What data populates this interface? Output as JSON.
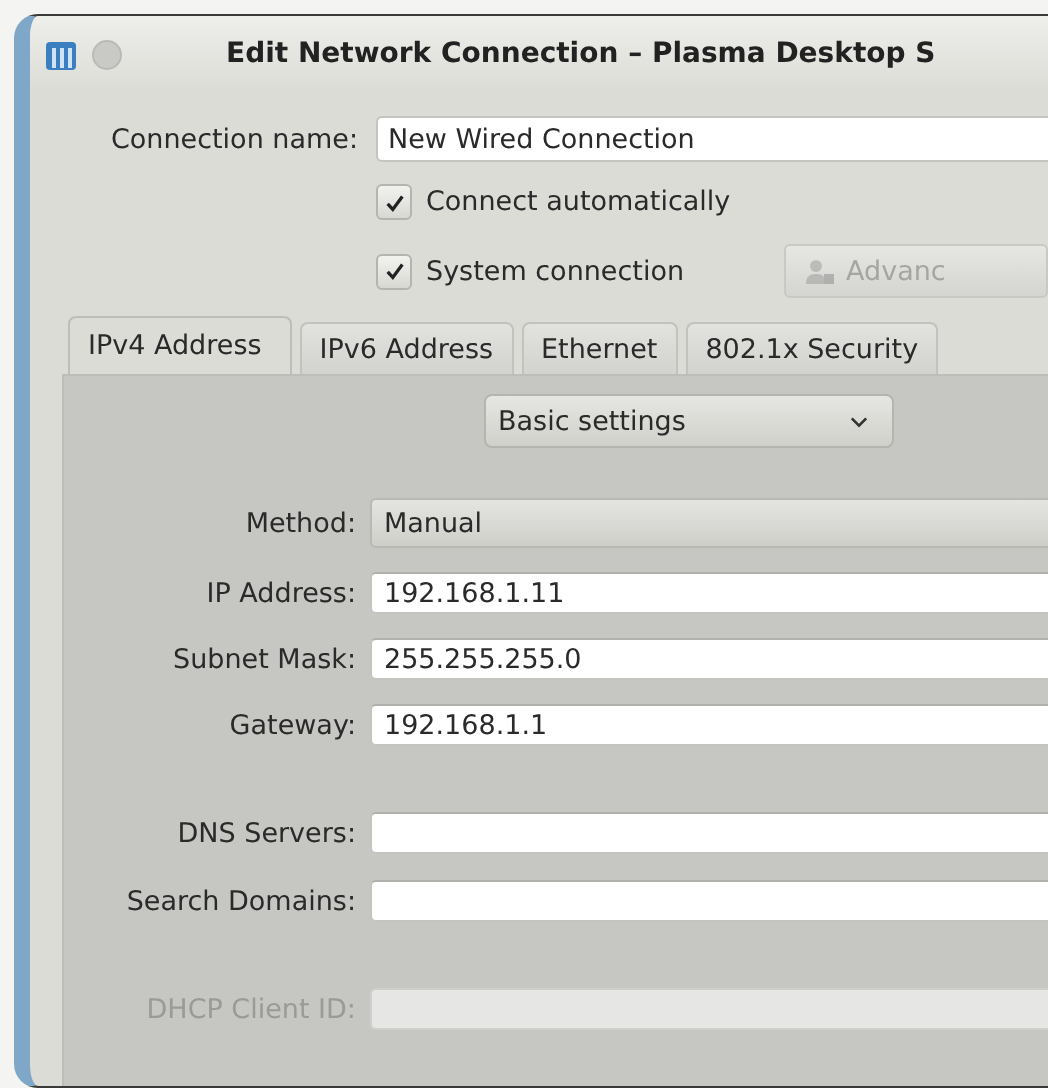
{
  "window": {
    "title": "Edit Network Connection – Plasma Desktop S"
  },
  "connection_name": {
    "label": "Connection name:",
    "value": "New Wired Connection"
  },
  "options": [
    {
      "label": "Connect automatically",
      "checked": true
    },
    {
      "label": "System connection",
      "checked": true
    }
  ],
  "advanced_button": {
    "label": "Advanc",
    "disabled": true
  },
  "tabs": [
    {
      "label": "IPv4 Address",
      "selected": true
    },
    {
      "label": "IPv6 Address",
      "selected": false
    },
    {
      "label": "Ethernet",
      "selected": false
    },
    {
      "label": "802.1x Security",
      "selected": false
    }
  ],
  "settings_mode": {
    "value": "Basic settings"
  },
  "field_groups": [
    [
      {
        "kind": "combo",
        "label": "Method:",
        "value": "Manual",
        "disabled": false
      },
      {
        "kind": "text",
        "label": "IP Address:",
        "value": "192.168.1.11",
        "disabled": false
      },
      {
        "kind": "text",
        "label": "Subnet Mask:",
        "value": "255.255.255.0",
        "disabled": false
      },
      {
        "kind": "text",
        "label": "Gateway:",
        "value": "192.168.1.1",
        "disabled": false
      }
    ],
    [
      {
        "kind": "text",
        "label": "DNS Servers:",
        "disabled": false
      },
      {
        "kind": "text",
        "label": "Search Domains:",
        "disabled": false
      }
    ],
    [
      {
        "kind": "text",
        "label": "DHCP Client ID:",
        "disabled": true
      }
    ]
  ]
}
